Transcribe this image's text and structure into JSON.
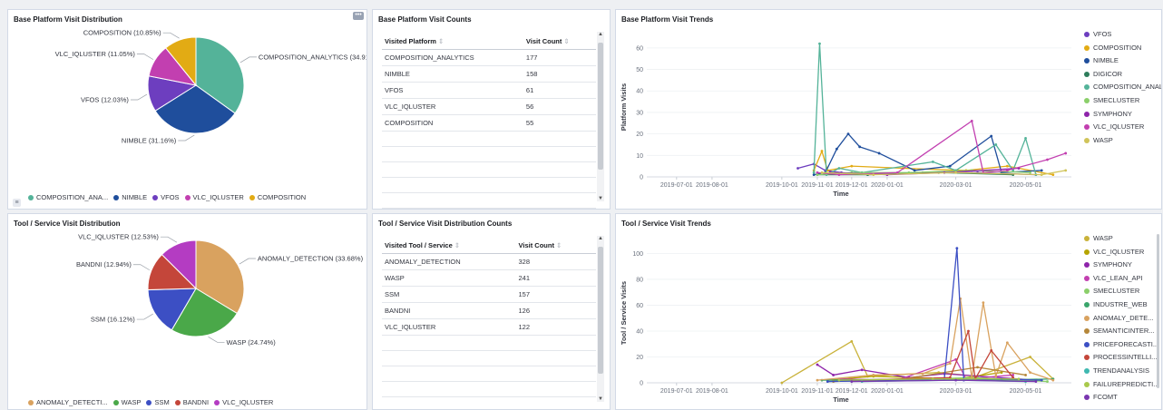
{
  "panels": {
    "p1": {
      "title": "Base Platform Visit Distribution"
    },
    "p2": {
      "title": "Base Platform Visit Counts"
    },
    "p3": {
      "title": "Base Platform Visit Trends"
    },
    "p4": {
      "title": "Tool / Service Visit Distribution"
    },
    "p5": {
      "title": "Tool / Service Visit Distribution Counts"
    },
    "p6": {
      "title": "Tool / Service Visit Trends"
    }
  },
  "menu_icon": "ellipsis-icon",
  "legend_toggle_icon": "list-icon",
  "platform_pie": {
    "slices": [
      {
        "name": "COMPOSITION_ANALYTICS",
        "pct": 34.91,
        "label": "COMPOSITION_ANALYTICS (34.91%)",
        "color": "#54b399"
      },
      {
        "name": "NIMBLE",
        "pct": 31.16,
        "label": "NIMBLE (31.16%)",
        "color": "#1f4e9c"
      },
      {
        "name": "VFOS",
        "pct": 12.03,
        "label": "VFOS (12.03%)",
        "color": "#6d3ebf"
      },
      {
        "name": "VLC_IQLUSTER",
        "pct": 11.05,
        "label": "VLC_IQLUSTER (11.05%)",
        "color": "#c23fb0"
      },
      {
        "name": "COMPOSITION",
        "pct": 10.85,
        "label": "COMPOSITION (10.85%)",
        "color": "#e2ab14"
      }
    ],
    "legend": [
      "COMPOSITION_ANA...",
      "NIMBLE",
      "VFOS",
      "VLC_IQLUSTER",
      "COMPOSITION"
    ]
  },
  "platform_table": {
    "headers": [
      "Visited Platform",
      "Visit Count"
    ],
    "rows": [
      [
        "COMPOSITION_ANALYTICS",
        "177"
      ],
      [
        "NIMBLE",
        "158"
      ],
      [
        "VFOS",
        "61"
      ],
      [
        "VLC_IQLUSTER",
        "56"
      ],
      [
        "COMPOSITION",
        "55"
      ]
    ]
  },
  "tool_pie": {
    "slices": [
      {
        "name": "ANOMALY_DETECTION",
        "pct": 33.68,
        "label": "ANOMALY_DETECTION (33.68%)",
        "color": "#d9a25f"
      },
      {
        "name": "WASP",
        "pct": 24.74,
        "label": "WASP (24.74%)",
        "color": "#4aa849"
      },
      {
        "name": "SSM",
        "pct": 16.12,
        "label": "SSM (16.12%)",
        "color": "#3c4fc4"
      },
      {
        "name": "BANDNI",
        "pct": 12.94,
        "label": "BANDNI (12.94%)",
        "color": "#c4463a"
      },
      {
        "name": "VLC_IQLUSTER",
        "pct": 12.53,
        "label": "VLC_IQLUSTER (12.53%)",
        "color": "#b43cc2"
      }
    ],
    "legend": [
      "ANOMALY_DETECTI...",
      "WASP",
      "SSM",
      "BANDNI",
      "VLC_IQLUSTER"
    ]
  },
  "tool_table": {
    "headers": [
      "Visited Tool / Service",
      "Visit Count"
    ],
    "rows": [
      [
        "ANOMALY_DETECTION",
        "328"
      ],
      [
        "WASP",
        "241"
      ],
      [
        "SSM",
        "157"
      ],
      [
        "BANDNI",
        "126"
      ],
      [
        "VLC_IQLUSTER",
        "122"
      ]
    ]
  },
  "chart_data": [
    {
      "type": "line",
      "title": "Base Platform Visit Trends",
      "xlabel": "Time",
      "ylabel": "Platform Visits",
      "ylim": [
        0,
        65
      ],
      "yticks": [
        0,
        10,
        20,
        30,
        40,
        50,
        60
      ],
      "xticks": [
        "2019-07-01",
        "2019-08-01",
        "2019-10-01",
        "2019-11-01",
        "2019-12-01",
        "2020-01-01",
        "2020-03-01",
        "2020-05-01"
      ],
      "legend_placement": "right",
      "series": [
        {
          "name": "VFOS",
          "color": "#6d3ebf",
          "points": [
            [
              "2019-10-15",
              4
            ],
            [
              "2019-10-29",
              6
            ],
            [
              "2019-11-08",
              3
            ],
            [
              "2019-11-22",
              2
            ],
            [
              "2019-12-15",
              1
            ],
            [
              "2020-02-01",
              2
            ],
            [
              "2020-03-20",
              2
            ],
            [
              "2020-05-10",
              1
            ]
          ]
        },
        {
          "name": "COMPOSITION",
          "color": "#e2ab14",
          "points": [
            [
              "2019-10-29",
              3
            ],
            [
              "2019-11-05",
              12
            ],
            [
              "2019-11-10",
              3
            ],
            [
              "2019-12-01",
              5
            ],
            [
              "2020-01-15",
              4
            ],
            [
              "2020-03-10",
              3
            ],
            [
              "2020-04-15",
              5
            ],
            [
              "2020-05-25",
              1
            ]
          ]
        },
        {
          "name": "NIMBLE",
          "color": "#1f4e9c",
          "points": [
            [
              "2019-10-29",
              1
            ],
            [
              "2019-11-08",
              2
            ],
            [
              "2019-11-18",
              13
            ],
            [
              "2019-11-28",
              20
            ],
            [
              "2019-12-08",
              14
            ],
            [
              "2019-12-25",
              11
            ],
            [
              "2020-01-25",
              3
            ],
            [
              "2020-02-25",
              5
            ],
            [
              "2020-04-01",
              19
            ],
            [
              "2020-04-10",
              2
            ],
            [
              "2020-05-15",
              3
            ]
          ]
        },
        {
          "name": "DIGICOR",
          "color": "#2e7d5b",
          "points": [
            [
              "2019-11-01",
              1
            ],
            [
              "2019-12-15",
              1
            ],
            [
              "2020-02-15",
              2
            ],
            [
              "2020-04-20",
              1
            ]
          ]
        },
        {
          "name": "COMPOSITION_ANALYTICS",
          "color": "#54b399",
          "points": [
            [
              "2019-10-29",
              2
            ],
            [
              "2019-11-03",
              62
            ],
            [
              "2019-11-09",
              1
            ],
            [
              "2019-11-20",
              4
            ],
            [
              "2019-12-10",
              2
            ],
            [
              "2020-02-10",
              7
            ],
            [
              "2020-03-01",
              3
            ],
            [
              "2020-04-05",
              15
            ],
            [
              "2020-04-20",
              3
            ],
            [
              "2020-05-01",
              18
            ],
            [
              "2020-05-10",
              1
            ]
          ]
        },
        {
          "name": "SMECLUSTER",
          "color": "#8bcf6a",
          "points": [
            [
              "2019-11-01",
              1
            ],
            [
              "2019-12-01",
              2
            ],
            [
              "2020-01-20",
              2
            ],
            [
              "2020-03-15",
              3
            ],
            [
              "2020-05-05",
              2
            ]
          ]
        },
        {
          "name": "SYMPHONY",
          "color": "#8e24aa",
          "points": [
            [
              "2019-11-12",
              2
            ],
            [
              "2020-01-01",
              1
            ],
            [
              "2020-02-20",
              2
            ],
            [
              "2020-04-25",
              4
            ]
          ]
        },
        {
          "name": "VLC_IQLUSTER",
          "color": "#c23fb0",
          "points": [
            [
              "2019-11-01",
              2
            ],
            [
              "2019-11-20",
              1
            ],
            [
              "2020-01-10",
              2
            ],
            [
              "2020-03-15",
              26
            ],
            [
              "2020-03-25",
              2
            ],
            [
              "2020-04-15",
              3
            ],
            [
              "2020-05-20",
              8
            ],
            [
              "2020-06-05",
              11
            ]
          ]
        },
        {
          "name": "WASP",
          "color": "#d0c45a",
          "points": [
            [
              "2019-11-05",
              2
            ],
            [
              "2019-12-20",
              1
            ],
            [
              "2020-03-01",
              2
            ],
            [
              "2020-05-15",
              1
            ],
            [
              "2020-06-05",
              3
            ]
          ]
        }
      ]
    },
    {
      "type": "line",
      "title": "Tool / Service Visit Trends",
      "xlabel": "Time",
      "ylabel": "Tool / Service Visits",
      "ylim": [
        0,
        108
      ],
      "yticks": [
        0,
        20,
        40,
        60,
        80,
        100
      ],
      "xticks": [
        "2019-07-01",
        "2019-08-01",
        "2019-10-01",
        "2019-11-01",
        "2019-12-01",
        "2020-01-01",
        "2020-03-01",
        "2020-05-01"
      ],
      "legend_placement": "right",
      "series": [
        {
          "name": "WASP",
          "color": "#c9b23a",
          "points": [
            [
              "2019-10-01",
              0
            ],
            [
              "2019-12-01",
              32
            ],
            [
              "2019-12-15",
              5
            ],
            [
              "2020-02-15",
              8
            ],
            [
              "2020-03-20",
              5
            ],
            [
              "2020-05-05",
              20
            ],
            [
              "2020-05-25",
              3
            ]
          ]
        },
        {
          "name": "VLC_IQLUSTER",
          "color": "#b5a400",
          "points": [
            [
              "2019-11-10",
              2
            ],
            [
              "2019-12-20",
              5
            ],
            [
              "2020-03-01",
              3
            ],
            [
              "2020-04-10",
              8
            ]
          ]
        },
        {
          "name": "SYMPHONY",
          "color": "#8e24aa",
          "points": [
            [
              "2019-11-01",
              14
            ],
            [
              "2019-11-15",
              6
            ],
            [
              "2019-12-10",
              10
            ],
            [
              "2020-01-20",
              4
            ],
            [
              "2020-02-20",
              7
            ],
            [
              "2020-05-10",
              2
            ]
          ]
        },
        {
          "name": "VLC_LEAN_API",
          "color": "#c23fb0",
          "points": [
            [
              "2019-11-20",
              3
            ],
            [
              "2020-01-10",
              2
            ],
            [
              "2020-03-01",
              18
            ],
            [
              "2020-03-10",
              3
            ],
            [
              "2020-04-20",
              6
            ]
          ]
        },
        {
          "name": "SMECLUSTER",
          "color": "#8bcf6a",
          "points": [
            [
              "2019-11-10",
              1
            ],
            [
              "2020-01-01",
              2
            ],
            [
              "2020-03-15",
              4
            ],
            [
              "2020-05-20",
              1
            ]
          ]
        },
        {
          "name": "INDUSTRE_WEB",
          "color": "#3aa56b",
          "points": [
            [
              "2019-11-05",
              2
            ],
            [
              "2020-02-01",
              3
            ],
            [
              "2020-04-01",
              2
            ],
            [
              "2020-05-25",
              3
            ]
          ]
        },
        {
          "name": "ANOMALY_DETE...",
          "color": "#d9a25f",
          "points": [
            [
              "2019-11-01",
              2
            ],
            [
              "2019-12-20",
              6
            ],
            [
              "2020-02-01",
              7
            ],
            [
              "2020-02-25",
              15
            ],
            [
              "2020-03-05",
              65
            ],
            [
              "2020-03-15",
              4
            ],
            [
              "2020-03-25",
              62
            ],
            [
              "2020-04-05",
              5
            ],
            [
              "2020-04-15",
              31
            ],
            [
              "2020-05-05",
              8
            ],
            [
              "2020-05-25",
              2
            ]
          ]
        },
        {
          "name": "SEMANTICINTER...",
          "color": "#b5873a",
          "points": [
            [
              "2019-11-15",
              1
            ],
            [
              "2020-01-15",
              3
            ],
            [
              "2020-03-20",
              12
            ],
            [
              "2020-05-01",
              6
            ]
          ]
        },
        {
          "name": "PRICEFORECASTI...",
          "color": "#3c4fc4",
          "points": [
            [
              "2019-11-10",
              1
            ],
            [
              "2020-01-20",
              2
            ],
            [
              "2020-02-20",
              3
            ],
            [
              "2020-03-02",
              104
            ],
            [
              "2020-03-08",
              2
            ],
            [
              "2020-04-10",
              3
            ],
            [
              "2020-05-15",
              2
            ]
          ]
        },
        {
          "name": "PROCESSINTELLI...",
          "color": "#c4463a",
          "points": [
            [
              "2019-12-01",
              2
            ],
            [
              "2020-02-25",
              4
            ],
            [
              "2020-03-12",
              40
            ],
            [
              "2020-03-18",
              3
            ],
            [
              "2020-04-01",
              25
            ],
            [
              "2020-04-20",
              4
            ]
          ]
        },
        {
          "name": "TRENDANALYSIS",
          "color": "#3fb8b0",
          "points": [
            [
              "2019-12-10",
              1
            ],
            [
              "2020-03-01",
              2
            ],
            [
              "2020-05-01",
              1
            ]
          ]
        },
        {
          "name": "FAILUREPREDICTI...",
          "color": "#a9c94c",
          "points": [
            [
              "2019-11-20",
              2
            ],
            [
              "2020-02-10",
              3
            ],
            [
              "2020-04-25",
              3
            ]
          ]
        },
        {
          "name": "FCOMT",
          "color": "#7a36b0",
          "points": [
            [
              "2019-12-01",
              1
            ],
            [
              "2020-03-01",
              2
            ],
            [
              "2020-05-10",
              1
            ]
          ]
        }
      ]
    }
  ]
}
